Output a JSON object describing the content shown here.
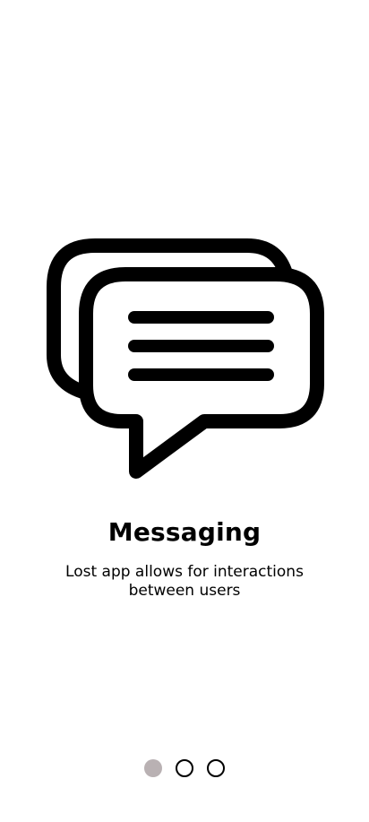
{
  "onboarding": {
    "icon": "chat-bubbles-icon",
    "title": "Messaging",
    "description": "Lost app allows for interactions between users",
    "pager": {
      "total_pages": 3,
      "current_page": 1,
      "active_color": "#b9b1b3",
      "inactive_border_color": "#000000"
    }
  }
}
